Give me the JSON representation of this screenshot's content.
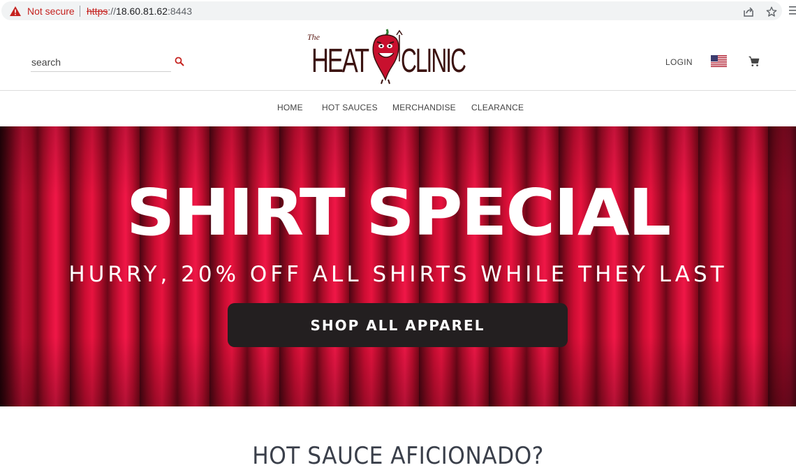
{
  "browser": {
    "security_label": "Not secure",
    "url_scheme": "https",
    "url_separator": "://",
    "url_host": "18.60.81.62",
    "url_port": ":8443"
  },
  "header": {
    "search_placeholder": "search",
    "logo_the": "The",
    "logo_heat": "HEAT",
    "logo_clinic": "CLINIC",
    "login_label": "LOGIN"
  },
  "nav": {
    "items": [
      {
        "label": "HOME"
      },
      {
        "label": "HOT SAUCES"
      },
      {
        "label": "MERCHANDISE"
      },
      {
        "label": "CLEARANCE"
      }
    ]
  },
  "hero": {
    "title": "SHIRT SPECIAL",
    "subtitle": "HURRY, 20% OFF ALL SHIRTS WHILE THEY LAST",
    "button_label": "SHOP ALL APPAREL"
  },
  "section": {
    "title": "HOT SAUCE AFICIONADO?"
  },
  "colors": {
    "accent": "#c5221f",
    "logo": "#3b1210",
    "hero_red": "#d8103a",
    "button_bg": "#231f20"
  }
}
